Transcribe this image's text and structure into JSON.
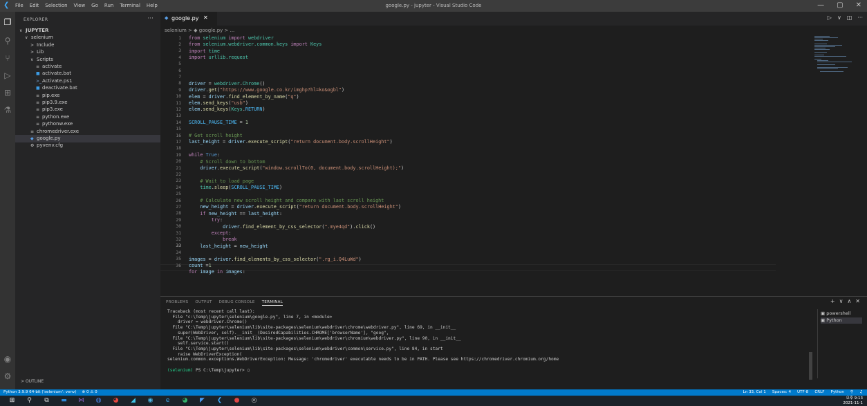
{
  "window": {
    "title": "google.py - jupyter - Visual Studio Code",
    "menu": [
      "File",
      "Edit",
      "Selection",
      "View",
      "Go",
      "Run",
      "Terminal",
      "Help"
    ],
    "controls": [
      "—",
      "▢",
      "✕"
    ]
  },
  "sidebar": {
    "header": "EXPLORER",
    "more": "···",
    "items": [
      {
        "label": "JUPYTER",
        "twisty": "∨",
        "icon": "",
        "indent": 0,
        "bold": true
      },
      {
        "label": "selenium",
        "twisty": "∨",
        "icon": "",
        "indent": 1
      },
      {
        "label": "Include",
        "twisty": ">",
        "icon": "",
        "indent": 2
      },
      {
        "label": "Lib",
        "twisty": ">",
        "icon": "",
        "indent": 2
      },
      {
        "label": "Scripts",
        "twisty": "∨",
        "icon": "",
        "indent": 2
      },
      {
        "label": "activate",
        "twisty": "",
        "icon": "≡",
        "iconClass": "exe",
        "indent": 3
      },
      {
        "label": "activate.bat",
        "twisty": "",
        "icon": "■",
        "iconClass": "bat",
        "indent": 3
      },
      {
        "label": "Activate.ps1",
        "twisty": "",
        "icon": ">_",
        "iconClass": "ps",
        "indent": 3
      },
      {
        "label": "deactivate.bat",
        "twisty": "",
        "icon": "■",
        "iconClass": "bat",
        "indent": 3
      },
      {
        "label": "pip.exe",
        "twisty": "",
        "icon": "≡",
        "iconClass": "exe",
        "indent": 3
      },
      {
        "label": "pip3.9.exe",
        "twisty": "",
        "icon": "≡",
        "iconClass": "exe",
        "indent": 3
      },
      {
        "label": "pip3.exe",
        "twisty": "",
        "icon": "≡",
        "iconClass": "exe",
        "indent": 3
      },
      {
        "label": "python.exe",
        "twisty": "",
        "icon": "≡",
        "iconClass": "exe",
        "indent": 3
      },
      {
        "label": "pythonw.exe",
        "twisty": "",
        "icon": "≡",
        "iconClass": "exe",
        "indent": 3
      },
      {
        "label": "chromedriver.exe",
        "twisty": "",
        "icon": "≡",
        "iconClass": "exe",
        "indent": 2
      },
      {
        "label": "google.py",
        "twisty": "",
        "icon": "◆",
        "iconClass": "py",
        "indent": 2,
        "selected": true
      },
      {
        "label": "pyvenv.cfg",
        "twisty": "",
        "icon": "⚙",
        "iconClass": "cfg",
        "indent": 2
      }
    ],
    "outline": "OUTLINE",
    "outline_twisty": ">"
  },
  "editor": {
    "tab": {
      "label": "google.py",
      "close": "✕"
    },
    "actions": [
      "▷",
      "∨",
      "◫",
      "···"
    ],
    "breadcrumb": "selenium > ◆ google.py > ...",
    "line_numbers": [
      "1",
      "2",
      "3",
      "4",
      "5",
      "6",
      "7",
      "8",
      "9",
      "10",
      "11",
      "12",
      "13",
      "14",
      "15",
      "16",
      "17",
      "18",
      "19",
      "20",
      "21",
      "22",
      "23",
      "24",
      "25",
      "26",
      "27",
      "28",
      "29",
      "30",
      "31",
      "32",
      "33",
      "34",
      "35",
      "36"
    ],
    "current_line": 33
  },
  "panel": {
    "tabs": [
      "PROBLEMS",
      "OUTPUT",
      "DEBUG CONSOLE",
      "TERMINAL"
    ],
    "active_tab": "TERMINAL",
    "actions": [
      "+",
      "∨",
      "∧",
      "✕"
    ],
    "terminal_lines": [
      "Traceback (most recent call last):",
      "  File \"c:\\Temp\\jupyter\\selenium\\google.py\", line 7, in <module>",
      "    driver = webdriver.Chrome()",
      "  File \"C:\\Temp\\jupyter\\selenium\\lib\\site-packages\\selenium\\webdriver\\chrome\\webdriver.py\", line 69, in __init__",
      "    super(WebDriver, self).__init__(DesiredCapabilities.CHROME['browserName'], \"goog\",",
      "  File \"C:\\Temp\\jupyter\\selenium\\lib\\site-packages\\selenium\\webdriver\\chromium\\webdriver.py\", line 90, in __init__",
      "    self.service.start()",
      "  File \"C:\\Temp\\jupyter\\selenium\\lib\\site-packages\\selenium\\webdriver\\common\\service.py\", line 84, in start",
      "    raise WebDriverException(",
      "selenium.common.exceptions.WebDriverException: Message: 'chromedriver' executable needs to be in PATH. Please see https://chromedriver.chromium.org/home"
    ],
    "prompt_env": "(selenium)",
    "prompt": " PS C:\\Temp\\jupyter> ",
    "cursor": "▯",
    "terminals": [
      {
        "icon": "▣",
        "label": "powershell"
      },
      {
        "icon": "▣",
        "label": "Python"
      }
    ]
  },
  "statusbar": {
    "left": [
      "Python 3.9.9 64-bit ('selenium': venv)",
      "⊗ 0 ⚠ 0"
    ],
    "right": [
      "Ln 33, Col 1",
      "Spaces: 4",
      "UTF-8",
      "CRLF",
      "Python",
      "⚲",
      "♫"
    ]
  },
  "taskbar": {
    "clock_time": "오후 9:13",
    "clock_date": "2021-11-1"
  }
}
